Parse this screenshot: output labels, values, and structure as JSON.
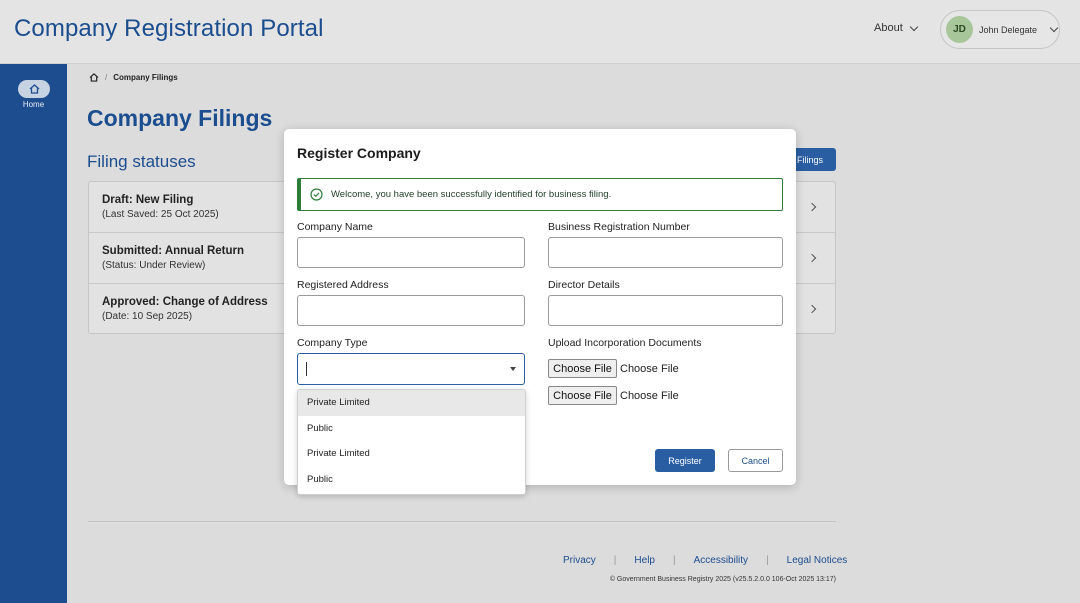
{
  "header": {
    "app_title": "Company Registration Portal",
    "about_label": "About",
    "user": {
      "initials": "JD",
      "name": "John Delegate"
    }
  },
  "sidebar": {
    "items": [
      {
        "label": "Home",
        "icon": "home-icon"
      }
    ]
  },
  "breadcrumb": {
    "current": "Company Filings"
  },
  "main": {
    "page_title": "Company Filings",
    "section_title": "Filing statuses",
    "new_filing_label": "Filings",
    "statuses": [
      {
        "title": "Draft: New Filing",
        "sub": "(Last Saved: 25 Oct 2025)"
      },
      {
        "title": "Submitted: Annual Return",
        "sub": "(Status: Under Review)"
      },
      {
        "title": "Approved: Change of Address",
        "sub": "(Date: 10 Sep 2025)"
      }
    ]
  },
  "modal": {
    "title": "Register Company",
    "alert": "Welcome, you have been successfully identified for business filing.",
    "company_name_label": "Company Name",
    "company_name_value": "",
    "brn_label": "Business Registration Number",
    "brn_value": "",
    "address_label": "Registered Address",
    "address_value": "",
    "director_label": "Director Details",
    "director_value": "",
    "company_type_label": "Company Type",
    "upload_label": "Upload Incorporation Documents",
    "file_button_label": "Choose File",
    "file_status": "Choose File",
    "register_label": "Register",
    "cancel_label": "Cancel"
  },
  "dropdown": {
    "options": [
      "Private Limited",
      "Public",
      "Private Limited",
      "Public"
    ]
  },
  "footer": {
    "links": [
      "Privacy",
      "Help",
      "Accessibility",
      "Legal Notices"
    ],
    "copyright": "© Government Business Registry 2025 (v25.5.2.0.0 106-Oct 2025 13:17)"
  },
  "colors": {
    "brand": "#1e4d8f",
    "accent": "#2a5ea3",
    "success": "#2e7d3a"
  }
}
